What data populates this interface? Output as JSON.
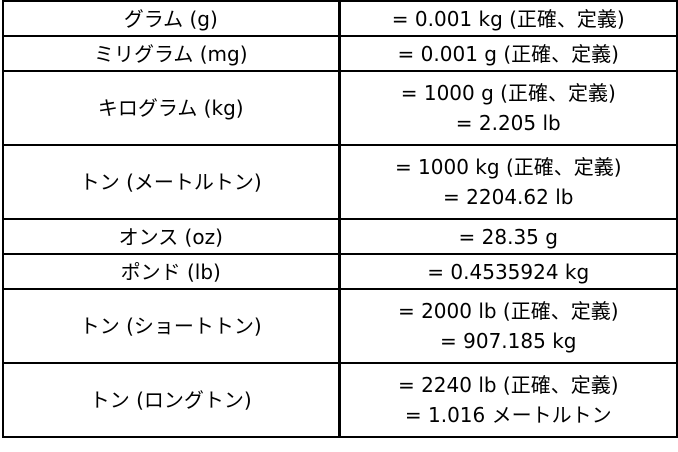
{
  "table": {
    "rows": [
      {
        "unit": "グラム (g)",
        "values": [
          "= 0.001 kg (正確、定義)"
        ]
      },
      {
        "unit": "ミリグラム (mg)",
        "values": [
          "= 0.001 g (正確、定義)"
        ]
      },
      {
        "unit": "キログラム (kg)",
        "values": [
          "= 1000 g (正確、定義)",
          "= 2.205 lb"
        ]
      },
      {
        "unit": "トン (メートルトン)",
        "values": [
          "= 1000 kg (正確、定義)",
          "= 2204.62 lb"
        ]
      },
      {
        "unit": "オンス (oz)",
        "values": [
          "= 28.35 g"
        ]
      },
      {
        "unit": "ポンド (lb)",
        "values": [
          "= 0.4535924 kg"
        ]
      },
      {
        "unit": "トン (ショートトン)",
        "values": [
          "= 2000 lb (正確、定義)",
          "= 907.185 kg"
        ]
      },
      {
        "unit": "トン (ロングトン)",
        "values": [
          "= 2240 lb (正確、定義)",
          "= 1.016 メートルトン"
        ]
      }
    ]
  }
}
